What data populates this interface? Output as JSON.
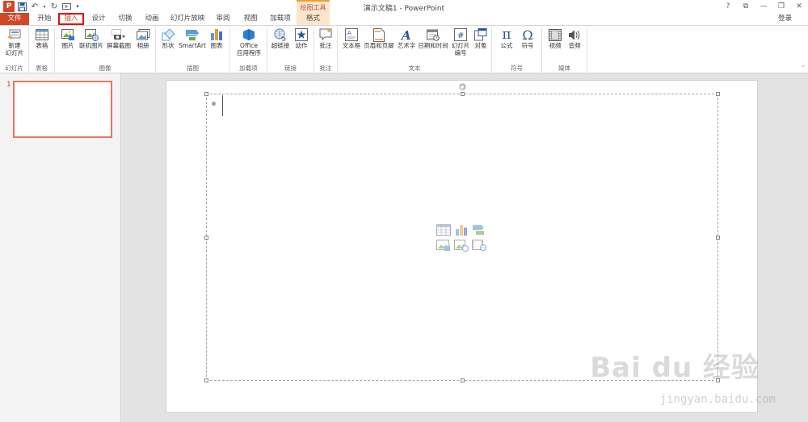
{
  "window": {
    "title": "演示文稿1 - PowerPoint",
    "contextual_group": "绘图工具",
    "app_logo": "P",
    "signin": "登录",
    "controls": [
      "?",
      "⧉",
      "—",
      "❐",
      "✕"
    ]
  },
  "tabs": [
    {
      "label": "文件"
    },
    {
      "label": "开始"
    },
    {
      "label": "插入"
    },
    {
      "label": "设计"
    },
    {
      "label": "切换"
    },
    {
      "label": "动画"
    },
    {
      "label": "幻灯片放映"
    },
    {
      "label": "审阅"
    },
    {
      "label": "视图"
    },
    {
      "label": "加载项"
    },
    {
      "label": "格式"
    }
  ],
  "ribbon": {
    "groups": {
      "slides": "幻灯片",
      "tables": "表格",
      "images": "图像",
      "illustrations": "插图",
      "addins": "加载项",
      "links": "链接",
      "comments": "批注",
      "text": "文本",
      "symbols": "符号",
      "media": "媒体"
    },
    "buttons": {
      "new_slide": "新建\n幻灯片",
      "table": "表格",
      "picture": "图片",
      "online_picture": "联机图片",
      "screenshot": "屏幕截图",
      "album": "相册",
      "shapes": "形状",
      "smartart": "SmartArt",
      "chart": "图表",
      "office_apps_1": "Office",
      "office_apps_2": "应用程序",
      "hyperlink": "超链接",
      "action": "动作",
      "comment": "批注",
      "textbox": "文本框",
      "header_footer": "页眉和页脚",
      "wordart": "艺术字",
      "datetime": "日期和时间",
      "slide_number_1": "幻灯片",
      "slide_number_2": "编号",
      "object": "对象",
      "equation": "公式",
      "symbol": "符号",
      "video": "视频",
      "audio": "音频"
    }
  },
  "slides_pane": {
    "slide_number": "1"
  },
  "watermark": {
    "main": "Bai du 经验",
    "url": "jingyan.baidu.com"
  },
  "colors": {
    "accent": "#d24726",
    "active_tab_border": "#e01010",
    "contextual": "#fbe6cc"
  }
}
